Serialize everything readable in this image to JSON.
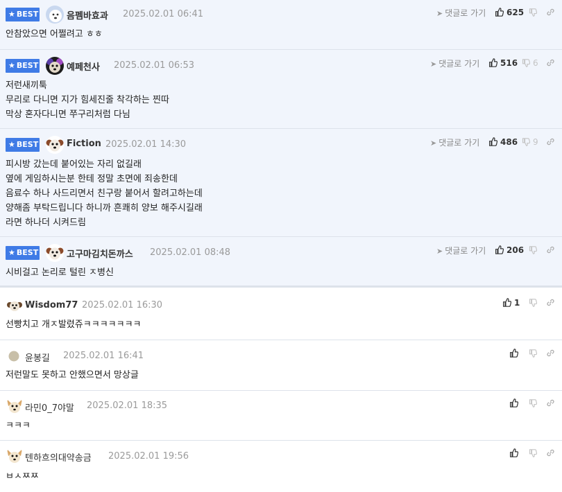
{
  "comments": [
    {
      "best": true,
      "badge_label": "BEST",
      "nickname": "음펨바효과",
      "date": "2025.02.01 06:41",
      "goto_label": "댓글로 가기",
      "likes": "625",
      "dislikes": "",
      "lines": [
        "안참았으면 어쩔려고 ㅎㅎ"
      ],
      "avatar": "white-dog-icon"
    },
    {
      "best": true,
      "badge_label": "BEST",
      "nickname": "예페천사",
      "date": "2025.02.01 06:53",
      "goto_label": "댓글로 가기",
      "likes": "516",
      "dislikes": "6",
      "lines": [
        "저런새끼툭",
        "무리로 다니면 지가 힘세진줄 착각하는 찐따",
        "막상 혼자다니면 쭈구리처럼 다님"
      ],
      "avatar": "dog-face-icon"
    },
    {
      "best": true,
      "badge_label": "BEST",
      "nickname": "Fiction",
      "date": "2025.02.01 14:30",
      "goto_label": "댓글로 가기",
      "likes": "486",
      "dislikes": "9",
      "lines": [
        "피시방 갔는데 붙어있는 자리 없길래",
        "옆에 게임하시는분 한테 정말 초면에 죄송한데",
        "음료수 하나 사드리면서 친구랑 붙어서 할려고하는데",
        "양해좀 부탁드립니다 하니까 흔쾌히 양보 해주시길래",
        "라면 하나더 시켜드림"
      ],
      "avatar": "dog-face-icon"
    },
    {
      "best": true,
      "badge_label": "BEST",
      "nickname": "고구마김치돈까스",
      "date": "2025.02.01 08:48",
      "goto_label": "댓글로 가기",
      "likes": "206",
      "dislikes": "",
      "lines": [
        "시비걸고 논리로 털린 ㅈ병신"
      ],
      "avatar": "dog-face-icon"
    },
    {
      "best": false,
      "nickname": "Wisdom77",
      "date": "2025.02.01 16:30",
      "likes": "1",
      "dislikes": "",
      "lines": [
        "선빵치고 개ㅈ발렸쥬ㅋㅋㅋㅋㅋㅋㅋ"
      ],
      "avatar": "puppy-icon"
    },
    {
      "best": false,
      "nickname": "윤봉길",
      "date": "2025.02.01 16:41",
      "likes": "",
      "dislikes": "",
      "lines": [
        "저런말도 못하고 안했으면서 망상글"
      ],
      "avatar": "dot-icon"
    },
    {
      "best": false,
      "nickname": "라민0_7야말",
      "date": "2025.02.01 18:35",
      "likes": "",
      "dislikes": "",
      "lines": [
        "ㅋㅋㅋ"
      ],
      "avatar": "chihuahua-icon"
    },
    {
      "best": false,
      "nickname": "텐하흐의대약송금",
      "date": "2025.02.01 19:56",
      "likes": "",
      "dislikes": "",
      "lines": [
        "ㅂㅅㅉㅉ"
      ],
      "avatar": "chihuahua-icon"
    }
  ],
  "colors": {
    "best_bg": "#f1f5fc",
    "badge": "#3f7be6",
    "divider": "#dde2ea"
  }
}
